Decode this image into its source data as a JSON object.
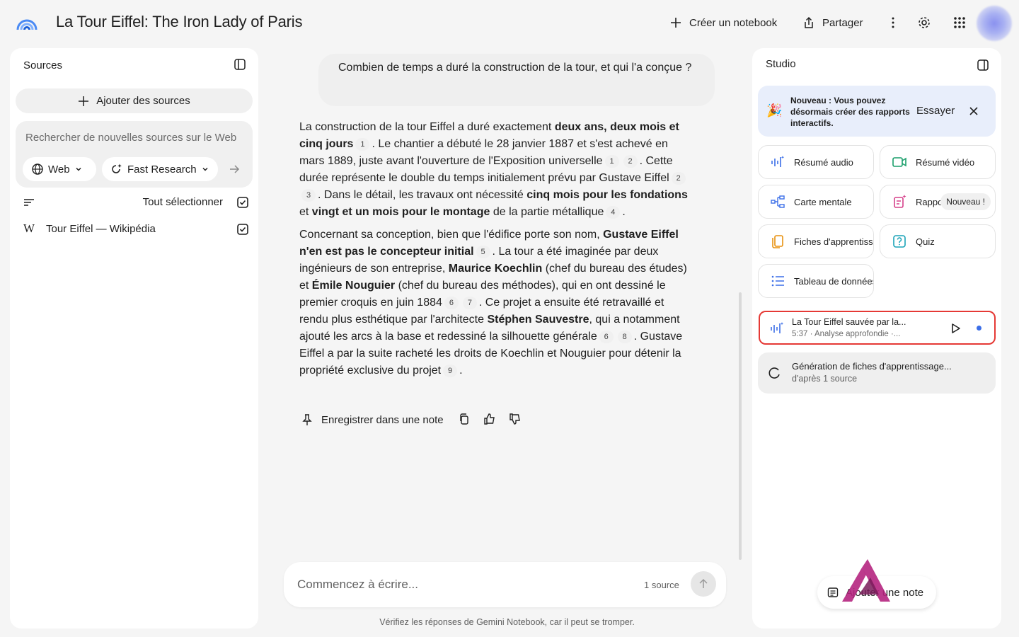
{
  "header": {
    "title": "La Tour Eiffel: The Iron Lady of Paris",
    "create_label": "Créer un notebook",
    "share_label": "Partager"
  },
  "sources": {
    "title": "Sources",
    "add_label": "Ajouter des sources",
    "search_placeholder": "Rechercher de nouvelles sources sur le Web",
    "web_chip": "Web",
    "research_chip": "Fast Research",
    "select_all": "Tout sélectionner",
    "items": [
      {
        "label": "Tour Eiffel — Wikipédia",
        "checked": true
      }
    ]
  },
  "chat": {
    "question": "Combien de temps a duré la construction de la tour, et qui l'a conçue ?",
    "p1": [
      "La construction de la tour Eiffel a duré exactement ",
      "deux ans, deux mois et cinq jours",
      ". Le chantier a débuté le 28 janvier 1887 et s'est achevé en mars 1889, juste avant l'ouverture de l'Exposition universelle",
      ". Cette durée représente le double du temps initialement prévu par Gustave Eiffel",
      ". Dans le détail, les travaux ont nécessité ",
      "cinq mois pour les fondations",
      " et ",
      "vingt et un mois pour le montage",
      " de la partie métallique",
      "."
    ],
    "p2": [
      "Concernant sa conception, bien que l'édifice porte son nom, ",
      "Gustave Eiffel n'en est pas le concepteur initial",
      ". La tour a été imaginée par deux ingénieurs de son entreprise, ",
      "Maurice Koechlin",
      " (chef du bureau des études) et ",
      "Émile Nouguier",
      " (chef du bureau des méthodes), qui en ont dessiné le premier croquis en juin 1884",
      ". Ce projet a ensuite été retravaillé et rendu plus esthétique par l'architecte ",
      "Stéphen Sauvestre",
      ", qui a notamment ajouté les arcs à la base et redessiné la silhouette générale",
      ". Gustave Eiffel a par la suite racheté les droits de Koechlin et Nouguier pour détenir la propriété exclusive du projet",
      "."
    ],
    "citations": [
      "1",
      "1",
      "2",
      "2",
      "3",
      "4",
      "5",
      "6",
      "7",
      "6",
      "8",
      "9"
    ],
    "save_note_label": "Enregistrer dans une note",
    "composer_placeholder": "Commencez à écrire...",
    "source_count": "1 source",
    "disclaimer": "Vérifiez les réponses de Gemini Notebook, car il peut se tromper."
  },
  "studio": {
    "title": "Studio",
    "banner_text": "Nouveau : Vous pouvez désormais créer des rapports interactifs.",
    "banner_try": "Essayer",
    "tiles": [
      {
        "label": "Résumé audio",
        "icon": "audio-wave-icon"
      },
      {
        "label": "Résumé vidéo",
        "icon": "video-icon"
      },
      {
        "label": "Carte mentale",
        "icon": "mind-map-icon"
      },
      {
        "label": "Rapports",
        "icon": "report-icon",
        "badge": "Nouveau !"
      },
      {
        "label": "Fiches d'apprentissage",
        "icon": "flashcards-icon"
      },
      {
        "label": "Quiz",
        "icon": "quiz-icon"
      },
      {
        "label": "Tableau de données",
        "icon": "table-icon"
      }
    ],
    "result": {
      "title": "La Tour Eiffel sauvée par la...",
      "subtitle": "5:37 · Analyse approfondie ·..."
    },
    "generating": {
      "title": "Génération de fiches d'apprentissage...",
      "subtitle": "d'après 1 source"
    },
    "add_note_label": "Ajouter une note"
  },
  "colors": {
    "accent_blue": "#3b6ee8",
    "highlight_red": "#e53935",
    "banner_bg": "#e8eefb"
  }
}
